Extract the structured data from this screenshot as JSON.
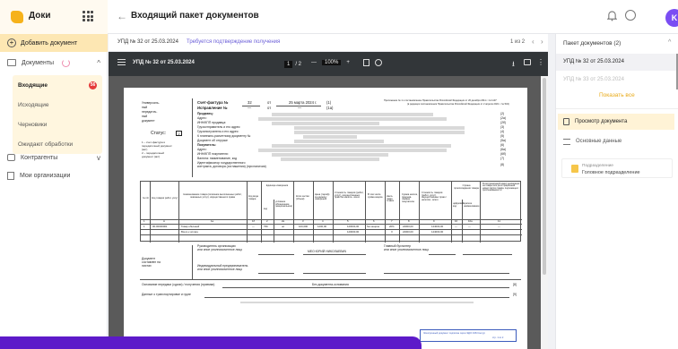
{
  "app": {
    "brand": "Доки",
    "avatar_letter": "K",
    "accent": "#f6b21b",
    "promo_color": "#5d1ac9"
  },
  "header": {
    "title": "Входящий пакет документов"
  },
  "sidebar": {
    "add_label": "Добавить документ",
    "docs_label": "Документы",
    "sub_items": [
      {
        "label": "Входящие",
        "badge": "56"
      },
      {
        "label": "Исходящие"
      },
      {
        "label": "Черновики"
      },
      {
        "label": "Ожидают обработки"
      }
    ],
    "contractors_label": "Контрагенты",
    "orgs_label": "Мои организации"
  },
  "doc_header": {
    "number": "УПД № 32 от 25.03.2024",
    "status": "Требуется подтверждение получения",
    "pager": "1 из 2"
  },
  "viewer": {
    "title": "УПД № 32 от 25.03.2024",
    "page": "1",
    "total": "/ 2",
    "zoom": "100%",
    "minus": "—",
    "plus": "+"
  },
  "invoice": {
    "doc_type": [
      "Универсаль-",
      "ный",
      "передаточ-",
      "ный",
      "документ"
    ],
    "sf_label": "Счет-фактура №",
    "sf_num": "32",
    "from": "от",
    "sf_date": "25 марта 2024 г.",
    "code1": "(1)",
    "fix_label": "Исправление №",
    "fix_num": "—",
    "fix_from": "от",
    "fix_val": "—",
    "code1a": "(1а)",
    "seller": "Продавец:",
    "address": "Адрес:",
    "inn": "ИНН/КПП продавца:",
    "shipper": "Грузоотправитель и его адрес:",
    "consignee": "Грузополучатель и его адрес:",
    "payment": "К платежно-расчетному документу №",
    "shipdoc": "Документ об отгрузке",
    "buyer": "Покупатель:",
    "buyer_addr": "Адрес:",
    "buyer_inn": "ИНН/КПП покупателя:",
    "currency": "Валюта: наименование, код",
    "gov": "Идентификатор государственного",
    "gov2": "контракта, договора (соглашения) (при наличии)",
    "status_label": "Статус:",
    "status_val": "2",
    "status_note1": "1 – счет-фактура и",
    "status_note2": "передаточный документ",
    "status_note3": "(акт)",
    "status_note4": "2 – передаточный",
    "status_note5": "документ (акт)",
    "appendix": "Приложение № 1 к постановлению Правительства Российской Федерации от 26 декабря 2011 г. № 1137",
    "appendix2": "(в редакции постановления Правительства Российской Федерации от 2 апреля 2021 г. № 534)",
    "row_codes": [
      "(2)",
      "(2а)",
      "(2б)",
      "(3)",
      "(4)",
      "(5)",
      "(5а)",
      "(6)",
      "(6а)",
      "(6б)",
      "(7)",
      "(8)"
    ],
    "cols": [
      "№ п/п",
      "Код товара/ работ, услуг",
      "Наименование товара (описание выполненных работ, оказанных услуг), имущественного права",
      "Код вида товара",
      "Единица измерения",
      "код",
      "условное обозначение (национальное)",
      "Коли-чество (объем)",
      "Цена (тариф) за единицу измерения",
      "Стоимость товаров (работ, услуг), имущественных прав без налога - всего",
      "В том числе сумма акциза",
      "Нало-говая ставка",
      "Сумма налога, предъяв-ляемая покупателю",
      "Стоимость товаров (работ, услуг), имущественных прав с налогом - всего",
      "Страна происхождения товара",
      "цифровой код",
      "краткое наименование",
      "Регистрационный номер декларации на товары или регистрационный номер партии товара, подлежащего прослеживаемости"
    ],
    "col_nums": [
      "1",
      "А",
      "1а",
      "1б",
      "2",
      "2а",
      "3",
      "4",
      "5",
      "6",
      "7",
      "8",
      "9",
      "10",
      "10а",
      "11"
    ],
    "row": {
      "n": "1",
      "code": "00-00000001",
      "name": "Товар обычный",
      "vid": "—",
      "unit_code": "796",
      "unit": "шт",
      "qty": "100,000",
      "price": "1200,00",
      "sum": "120000,00",
      "excise": "без акциза",
      "rate": "20%",
      "tax": "24000,00",
      "total": "144000,00",
      "c1": "—",
      "c2": "—",
      "reg": "—"
    },
    "total_label": "Всего к оплате",
    "total_sum": "120000,00",
    "total_x": "Х",
    "total_tax": "24000,00",
    "total_all": "144000,00",
    "doc_signed": [
      "Документ",
      "составлен на",
      "листах"
    ],
    "head": "Руководитель организации",
    "head2": "или иное уполномоченное лицо",
    "signer": "МЕО ЮРИЙ НИКОЛАЕВИЧ",
    "chief": "Главный бухгалтер",
    "chief2": "или иное уполномоченное лицо",
    "ip": "Индивидуальный предприниматель",
    "ip2": "или иное уполномоченное лицо",
    "basis": "Основание передачи (сдачи) / получения (приемки)",
    "basis_val": "Без документа-основания",
    "transport": "Данные о транспортировке и грузе",
    "code8": "[8]",
    "code9": "[9]",
    "note1": "Электронный документ подписан через ЭДО СКБ Контур",
    "note2": "стр. 1 из 2"
  },
  "right_panel": {
    "head": "Пакет документов (2)",
    "item1": "УПД № 32 от 25.03.2024",
    "item2": "УПД № 33 от 25.03.2024",
    "show_all": "Показать все",
    "view_doc": "Просмотр документа",
    "main_data": "Основные данные",
    "sub_label": "Подразделение",
    "sub_value": "Головное подразделение"
  }
}
